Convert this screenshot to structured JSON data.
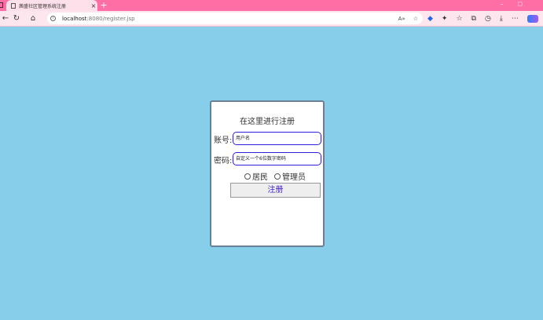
{
  "browser": {
    "tab_title": "茜盛社区管理系统注册",
    "tab_close": "×",
    "new_tab": "+",
    "url_host": "localhost",
    "url_path": ":8080/register.jsp"
  },
  "form": {
    "title": "在这里进行注册",
    "account_label": "账号:",
    "account_placeholder": "用户名",
    "password_label": "密码:",
    "password_placeholder": "自定义一个6位数字密码",
    "role_resident": "居民",
    "role_admin": "管理员",
    "submit_label": "注册"
  },
  "colors": {
    "page_background": "#87ceeb",
    "tab_bar": "#ff6fa5",
    "input_border": "#2e1fd9",
    "submit_text": "#4326c4"
  }
}
